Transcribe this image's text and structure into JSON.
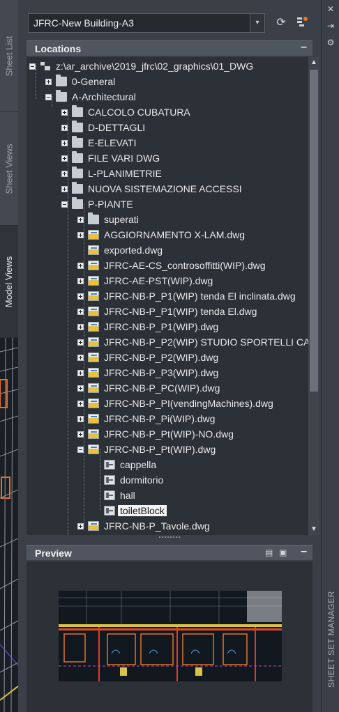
{
  "left_tabs": [
    "Sheet List",
    "Sheet Views",
    "Model Views"
  ],
  "sheet_set": {
    "selected": "JFRC-New Building-A3"
  },
  "locations": {
    "title": "Locations",
    "tree": [
      {
        "label": "z:\\ar_archive\\2019_jfrc\\02_graphics\\01_DWG",
        "level": 0,
        "icon": "server-icon",
        "expander": "minus"
      },
      {
        "label": "0-General",
        "level": 1,
        "icon": "folder-icon",
        "expander": "plus"
      },
      {
        "label": "A-Architectural",
        "level": 1,
        "icon": "folder-icon",
        "expander": "minus"
      },
      {
        "label": "CALCOLO CUBATURA",
        "level": 2,
        "icon": "folder-icon",
        "expander": "plus"
      },
      {
        "label": "D-DETTAGLI",
        "level": 2,
        "icon": "folder-icon",
        "expander": "plus"
      },
      {
        "label": "E-ELEVATI",
        "level": 2,
        "icon": "folder-icon",
        "expander": "plus"
      },
      {
        "label": "FILE VARI DWG",
        "level": 2,
        "icon": "folder-icon",
        "expander": "plus"
      },
      {
        "label": "L-PLANIMETRIE",
        "level": 2,
        "icon": "folder-icon",
        "expander": "plus"
      },
      {
        "label": "NUOVA SISTEMAZIONE ACCESSI",
        "level": 2,
        "icon": "folder-icon",
        "expander": "plus"
      },
      {
        "label": "P-PIANTE",
        "level": 2,
        "icon": "folder-icon",
        "expander": "minus"
      },
      {
        "label": "superati",
        "level": 3,
        "icon": "folder-icon",
        "expander": "plus"
      },
      {
        "label": "AGGIORNAMENTO X-LAM.dwg",
        "level": 3,
        "icon": "dwg-file-icon",
        "expander": "plus"
      },
      {
        "label": "exported.dwg",
        "level": 3,
        "icon": "dwg-file-icon",
        "expander": "none"
      },
      {
        "label": "JFRC-AE-CS_controsoffitti(WIP).dwg",
        "level": 3,
        "icon": "dwg-file-icon",
        "expander": "plus"
      },
      {
        "label": "JFRC-AE-PST(WIP).dwg",
        "level": 3,
        "icon": "dwg-file-icon",
        "expander": "plus"
      },
      {
        "label": "JFRC-NB-P_P1(WIP) tenda El inclinata.dwg",
        "level": 3,
        "icon": "dwg-file-icon",
        "expander": "plus"
      },
      {
        "label": "JFRC-NB-P_P1(WIP) tenda El.dwg",
        "level": 3,
        "icon": "dwg-file-icon",
        "expander": "plus"
      },
      {
        "label": "JFRC-NB-P_P1(WIP).dwg",
        "level": 3,
        "icon": "dwg-file-icon",
        "expander": "plus"
      },
      {
        "label": "JFRC-NB-P_P2(WIP) STUDIO SPORTELLI CA",
        "level": 3,
        "icon": "dwg-file-icon",
        "expander": "plus"
      },
      {
        "label": "JFRC-NB-P_P2(WIP).dwg",
        "level": 3,
        "icon": "dwg-file-icon",
        "expander": "plus"
      },
      {
        "label": "JFRC-NB-P_P3(WIP).dwg",
        "level": 3,
        "icon": "dwg-file-icon",
        "expander": "plus"
      },
      {
        "label": "JFRC-NB-P_PC(WIP).dwg",
        "level": 3,
        "icon": "dwg-file-icon",
        "expander": "plus"
      },
      {
        "label": "JFRC-NB-P_PI(vendingMachines).dwg",
        "level": 3,
        "icon": "dwg-file-icon",
        "expander": "plus"
      },
      {
        "label": "JFRC-NB-P_Pi(WIP).dwg",
        "level": 3,
        "icon": "dwg-file-icon",
        "expander": "plus"
      },
      {
        "label": "JFRC-NB-P_Pt(WIP)-NO.dwg",
        "level": 3,
        "icon": "dwg-file-icon",
        "expander": "plus"
      },
      {
        "label": "JFRC-NB-P_Pt(WIP).dwg",
        "level": 3,
        "icon": "dwg-file-icon",
        "expander": "minus"
      },
      {
        "label": "cappella",
        "level": 4,
        "icon": "model-view-icon",
        "expander": "none"
      },
      {
        "label": "dormitorio",
        "level": 4,
        "icon": "model-view-icon",
        "expander": "none"
      },
      {
        "label": "hall",
        "level": 4,
        "icon": "model-view-icon",
        "expander": "none"
      },
      {
        "label": "toiletBlock",
        "level": 4,
        "icon": "model-view-icon",
        "expander": "none",
        "selected": true
      },
      {
        "label": "JFRC-NB-P_Tavole.dwg",
        "level": 3,
        "icon": "dwg-file-icon",
        "expander": "plus"
      }
    ]
  },
  "preview": {
    "title": "Preview"
  },
  "palette_title": "SHEET SET MANAGER",
  "colors": {
    "panel": "#3b4048",
    "tree_bg": "#2c3037",
    "header": "#50565f",
    "selection": "#f4f4f4"
  }
}
